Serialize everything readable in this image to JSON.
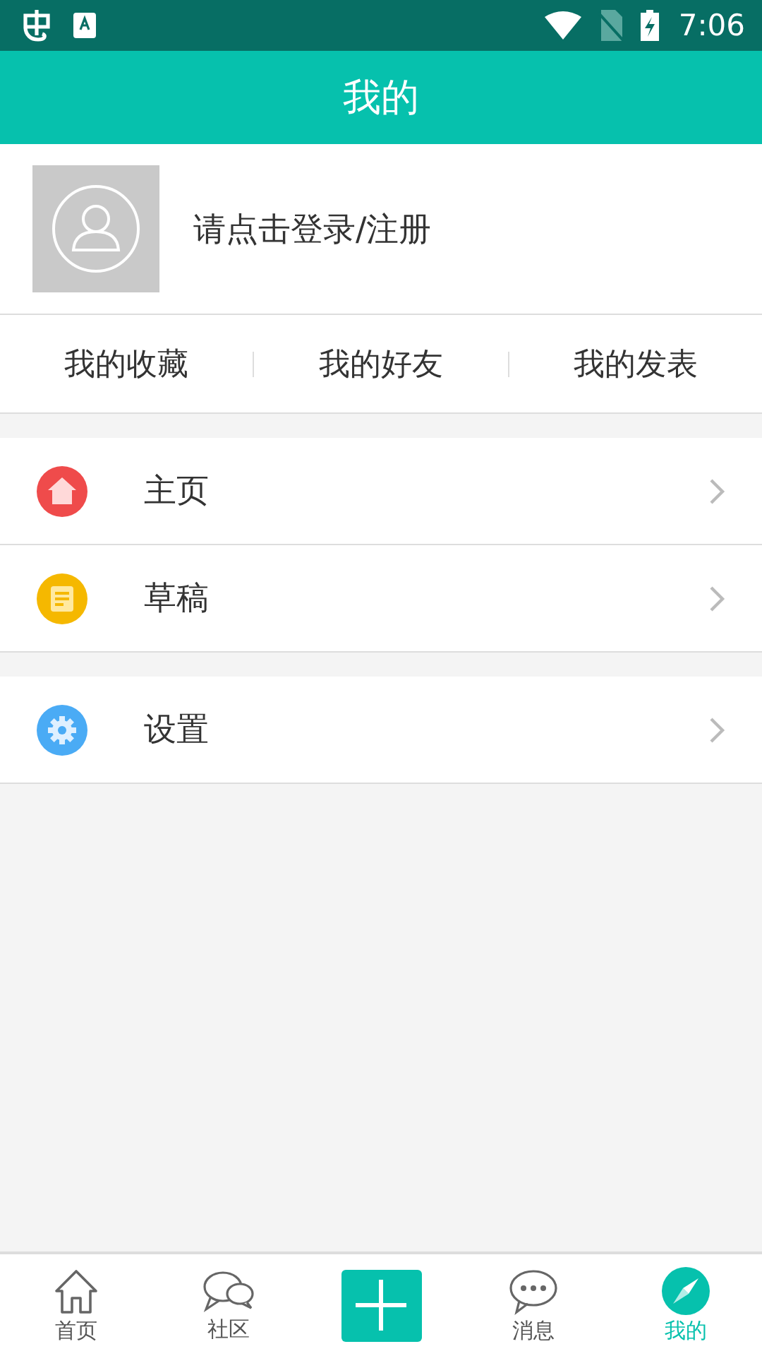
{
  "status_bar": {
    "time": "7:06"
  },
  "header": {
    "title": "我的"
  },
  "profile": {
    "login_text": "请点击登录/注册"
  },
  "quick_links": [
    "我的收藏",
    "我的好友",
    "我的发表"
  ],
  "menu_groups": [
    {
      "items": [
        {
          "kind": "home",
          "label": "主页"
        },
        {
          "kind": "draft",
          "label": "草稿"
        }
      ]
    },
    {
      "items": [
        {
          "kind": "settings",
          "label": "设置"
        }
      ]
    }
  ],
  "bottom_nav": [
    {
      "kind": "home",
      "label": "首页",
      "selected": false
    },
    {
      "kind": "community",
      "label": "社区",
      "selected": false
    },
    {
      "kind": "add",
      "selected": false
    },
    {
      "kind": "message",
      "label": "消息",
      "selected": false
    },
    {
      "kind": "mine",
      "label": "我的",
      "selected": true
    }
  ]
}
